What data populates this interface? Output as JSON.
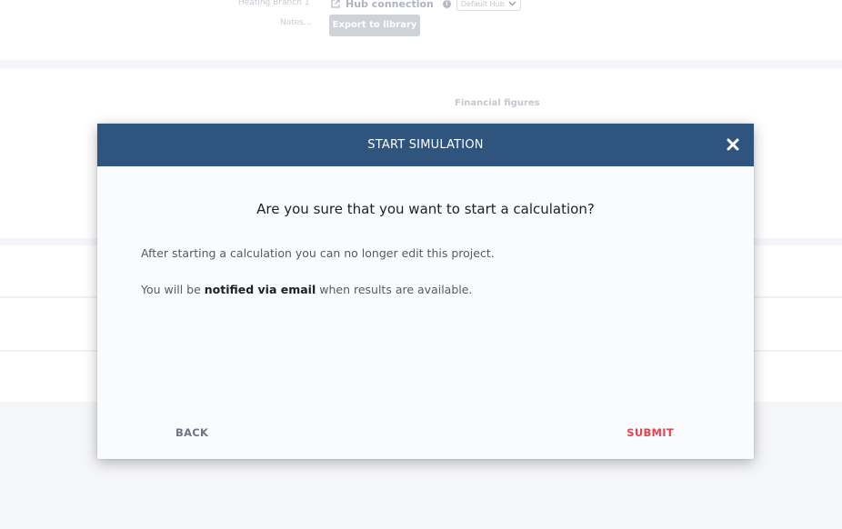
{
  "background": {
    "branch_label": "Heating Branch 1",
    "notes_label": "Notes...",
    "hub_connection_label": "Hub connection",
    "hub_select_value": "Default Hub",
    "export_button_label": "Export to library",
    "financial_figures_label": "Financial figures"
  },
  "modal": {
    "title": "START SIMULATION",
    "question": "Are you sure that you want to start a calculation?",
    "line1": "After starting a calculation you can no longer edit this project.",
    "line2_prefix": "You will be ",
    "line2_emphasis": "notified via email",
    "line2_suffix": " when results are available.",
    "back_label": "BACK",
    "submit_label": "SUBMIT"
  },
  "icons": {
    "close": "close-icon",
    "external_link": "external-link-icon",
    "info": "info-icon",
    "chevron_down": "chevron-down-icon"
  },
  "colors": {
    "header": "#2f547e",
    "submit": "#e8424f",
    "back": "#6f7482"
  }
}
